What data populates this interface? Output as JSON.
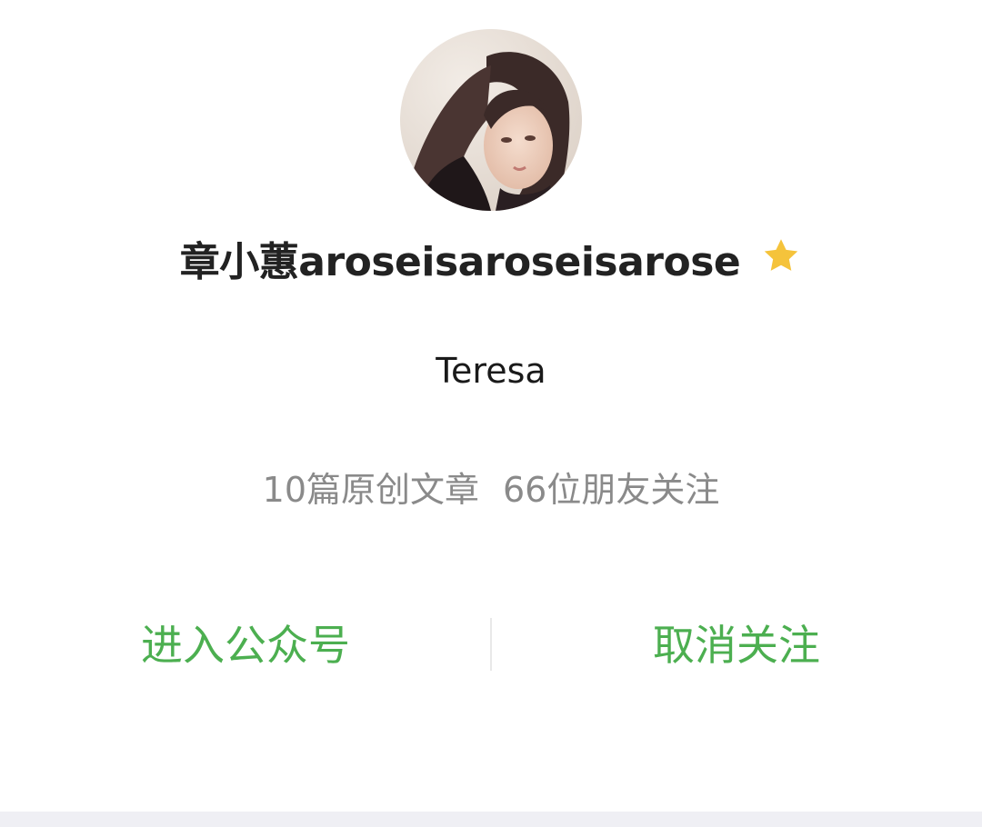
{
  "profile": {
    "name": "章小蕙aroseisaroseisarose",
    "verified_icon": "star-icon",
    "subtitle": "Teresa"
  },
  "stats": {
    "articles": "10篇原创文章",
    "followers": "66位朋友关注"
  },
  "actions": {
    "enter_label": "进入公众号",
    "unfollow_label": "取消关注"
  },
  "colors": {
    "action_green": "#4caf50",
    "star_gold": "#f5c33b",
    "stats_gray": "#8a8a8a"
  }
}
